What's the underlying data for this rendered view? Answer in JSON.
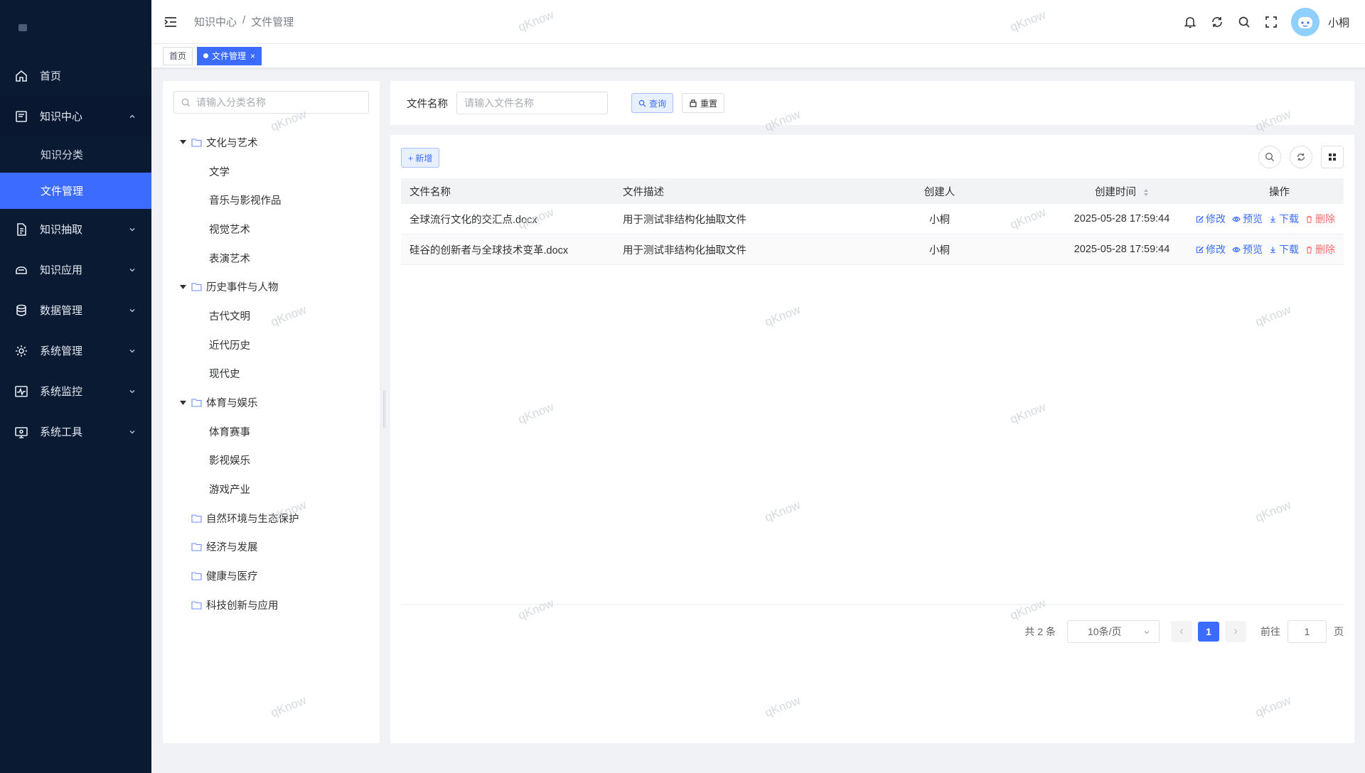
{
  "colors": {
    "sidebar_bg": "#0b1a33",
    "accent": "#3b6cff",
    "danger": "#f56c6c"
  },
  "sidebar": {
    "items": [
      {
        "label": "首页",
        "icon": "home-icon",
        "expandable": false
      },
      {
        "label": "知识中心",
        "icon": "book-icon",
        "expandable": true,
        "open": true,
        "children": [
          {
            "label": "知识分类",
            "active": false
          },
          {
            "label": "文件管理",
            "active": true
          }
        ]
      },
      {
        "label": "知识抽取",
        "icon": "document-extract-icon",
        "expandable": true
      },
      {
        "label": "知识应用",
        "icon": "cloud-app-icon",
        "expandable": true
      },
      {
        "label": "数据管理",
        "icon": "database-icon",
        "expandable": true
      },
      {
        "label": "系统管理",
        "icon": "gear-icon",
        "expandable": true
      },
      {
        "label": "系统监控",
        "icon": "monitor-pulse-icon",
        "expandable": true
      },
      {
        "label": "系统工具",
        "icon": "toolbox-icon",
        "expandable": true
      }
    ]
  },
  "header": {
    "breadcrumb": [
      "知识中心",
      "/",
      "文件管理"
    ],
    "username": "小桐",
    "icons": [
      "bell-icon",
      "refresh-icon",
      "search-icon",
      "fullscreen-icon"
    ]
  },
  "tags": [
    {
      "label": "首页",
      "active": false
    },
    {
      "label": "文件管理",
      "active": true,
      "close": "×"
    }
  ],
  "tree": {
    "search_placeholder": "请输入分类名称",
    "nodes": [
      {
        "label": "文化与艺术",
        "expanded": true,
        "children": [
          "文学",
          "音乐与影视作品",
          "视觉艺术",
          "表演艺术"
        ]
      },
      {
        "label": "历史事件与人物",
        "expanded": true,
        "children": [
          "古代文明",
          "近代历史",
          "现代史"
        ]
      },
      {
        "label": "体育与娱乐",
        "expanded": true,
        "children": [
          "体育赛事",
          "影视娱乐",
          "游戏产业"
        ]
      },
      {
        "label": "自然环境与生态保护",
        "expanded": false,
        "children": []
      },
      {
        "label": "经济与发展",
        "expanded": false,
        "children": []
      },
      {
        "label": "健康与医疗",
        "expanded": false,
        "children": []
      },
      {
        "label": "科技创新与应用",
        "expanded": false,
        "children": []
      }
    ]
  },
  "query": {
    "label": "文件名称",
    "placeholder": "请输入文件名称",
    "search_label": "查询",
    "reset_label": "重置"
  },
  "toolbar": {
    "add_label": "+ 新增"
  },
  "table": {
    "headers": [
      "文件名称",
      "文件描述",
      "创建人",
      "创建时间",
      "操作"
    ],
    "rows": [
      {
        "name": "全球流行文化的交汇点.docx",
        "desc": "用于测试非结构化抽取文件",
        "creator": "小桐",
        "time": "2025-05-28 17:59:44"
      },
      {
        "name": "硅谷的创新者与全球技术变革.docx",
        "desc": "用于测试非结构化抽取文件",
        "creator": "小桐",
        "time": "2025-05-28 17:59:44"
      }
    ],
    "ops": {
      "edit": "修改",
      "preview": "预览",
      "download": "下载",
      "delete": "删除"
    }
  },
  "pagination": {
    "total_text": "共 2 条",
    "page_size": "10条/页",
    "current_page": "1",
    "goto_label": "前往",
    "goto_value": "1",
    "page_suffix": "页"
  },
  "watermark": "qKnow"
}
